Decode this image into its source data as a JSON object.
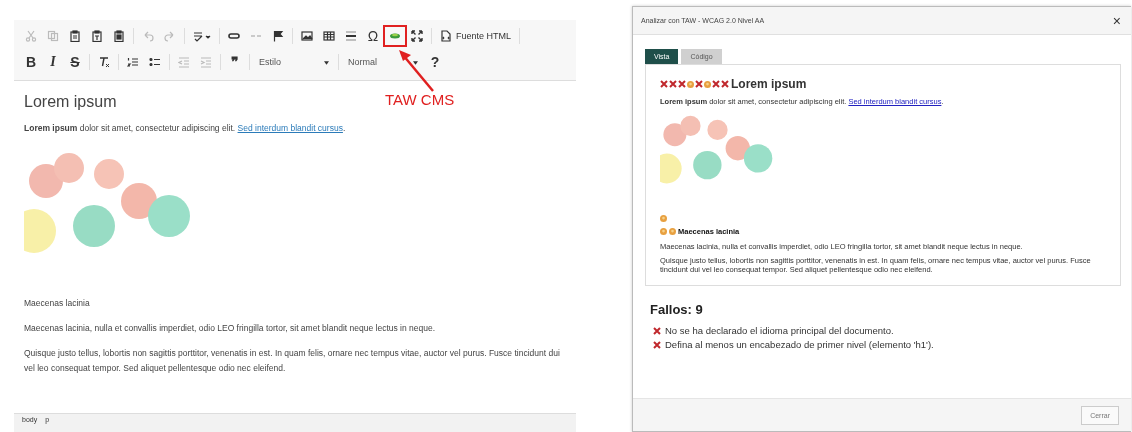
{
  "editor": {
    "toolbar_rows": [
      [
        {
          "kind": "cut",
          "disabled": true
        },
        {
          "kind": "copy",
          "disabled": true
        },
        {
          "kind": "paste",
          "disabled": false
        },
        {
          "kind": "paste-text",
          "disabled": false
        },
        {
          "kind": "paste-word",
          "disabled": false
        },
        {
          "kind": "sep"
        },
        {
          "kind": "undo",
          "disabled": true
        },
        {
          "kind": "redo",
          "disabled": true
        },
        {
          "kind": "sep"
        },
        {
          "kind": "spellcheck",
          "disabled": false
        },
        {
          "kind": "sep"
        },
        {
          "kind": "link",
          "disabled": false
        },
        {
          "kind": "unlink",
          "disabled": true
        },
        {
          "kind": "anchor",
          "disabled": false
        },
        {
          "kind": "sep"
        },
        {
          "kind": "image",
          "disabled": false
        },
        {
          "kind": "table",
          "disabled": false
        },
        {
          "kind": "rule",
          "disabled": false
        },
        {
          "kind": "glyph",
          "glyph": "Ω",
          "disabled": false
        },
        {
          "kind": "taw",
          "disabled": false,
          "highlighted": true
        },
        {
          "kind": "maximize",
          "disabled": false
        },
        {
          "kind": "sep"
        },
        {
          "kind": "source",
          "label": "Fuente HTML",
          "disabled": false
        },
        {
          "kind": "sep"
        }
      ],
      [
        {
          "kind": "bold",
          "glyph": "B",
          "disabled": false
        },
        {
          "kind": "italic",
          "glyph": "I",
          "disabled": false
        },
        {
          "kind": "strike",
          "glyph": "S",
          "disabled": false
        },
        {
          "kind": "sep"
        },
        {
          "kind": "clear-format",
          "disabled": false
        },
        {
          "kind": "sep"
        },
        {
          "kind": "numbered-list",
          "disabled": false
        },
        {
          "kind": "bulleted-list",
          "disabled": false
        },
        {
          "kind": "sep"
        },
        {
          "kind": "outdent",
          "disabled": true
        },
        {
          "kind": "indent",
          "disabled": true
        },
        {
          "kind": "sep"
        },
        {
          "kind": "bold",
          "glyph": "❞",
          "disabled": false
        },
        {
          "kind": "sep"
        },
        {
          "kind": "dropdown",
          "label": "Estilo"
        },
        {
          "kind": "sep"
        },
        {
          "kind": "dropdown",
          "label": "Normal"
        },
        {
          "kind": "bold",
          "glyph": "?",
          "disabled": false
        }
      ]
    ],
    "annotation": {
      "label": "TAW CMS"
    },
    "content": [
      {
        "kind": "heading",
        "text": "Lorem ipsum"
      },
      {
        "kind": "paragraph",
        "text": "**Lorem ipsum** dolor sit amet, consectetur adipiscing elit. ",
        "link": "Sed interdum blandit cursus",
        "tail": "."
      },
      {
        "kind": "image"
      },
      {
        "kind": "paragraph",
        "text": "Maecenas lacinia"
      },
      {
        "kind": "paragraph",
        "text": "Maecenas lacinia, nulla et convallis imperdiet, odio LEO fringilla tortor, sit amet blandit neque lectus in neque."
      },
      {
        "kind": "paragraph",
        "text": "Quisque justo tellus, lobortis non sagittis porttitor, venenatis in est. In quam felis, ornare nec tempus vitae, auctor vel purus. Fusce tincidunt dui vel leo consequat tempor. Sed aliquet pellentesque odio nec eleifend."
      }
    ],
    "path": [
      "body",
      "p"
    ]
  },
  "dialog": {
    "title": "Analizar con TAW - WCAG 2.0 Nivel AA",
    "close_glyph": "×",
    "tabs": [
      {
        "label": "Vista",
        "selected": true
      },
      {
        "label": "Código",
        "selected": false
      }
    ],
    "preview": [
      {
        "kind": "heading",
        "markers": [
          {
            "kind": "error"
          },
          {
            "kind": "error"
          },
          {
            "kind": "error"
          },
          {
            "kind": "warning"
          },
          {
            "kind": "error"
          },
          {
            "kind": "warning"
          },
          {
            "kind": "error"
          },
          {
            "kind": "error"
          }
        ],
        "text": "Lorem ipsum"
      },
      {
        "kind": "paragraph",
        "text": "**Lorem ipsum** dolor sit amet, consectetur adipiscing elit. ",
        "link": "Sed interdum blandit cursus",
        "tail": "."
      },
      {
        "kind": "image"
      },
      {
        "kind": "markers",
        "markers": [
          {
            "kind": "warning"
          }
        ]
      },
      {
        "kind": "subheading",
        "markers": [
          {
            "kind": "warning"
          },
          {
            "kind": "warning"
          }
        ],
        "text": "Maecenas lacinia"
      },
      {
        "kind": "paragraph",
        "text": "Maecenas lacinia, nulla et convallis imperdiet, odio LEO fringilla tortor, sit amet blandit neque lectus in neque."
      },
      {
        "kind": "paragraph",
        "text": "Quisque justo tellus, lobortis non sagittis porttitor, venenatis in est. In quam felis, ornare nec tempus vitae, auctor vel purus. Fusce tincidunt dui vel leo consequat tempor. Sed aliquet pellentesque odio nec eleifend."
      }
    ],
    "failures_title": "Fallos: 9",
    "failures": [
      {
        "text": "No se ha declarado el idioma principal del documento."
      },
      {
        "text": "Defina al menos un encabezado de primer nivel (elemento 'h1')."
      }
    ],
    "close_button": "Cerrar"
  }
}
